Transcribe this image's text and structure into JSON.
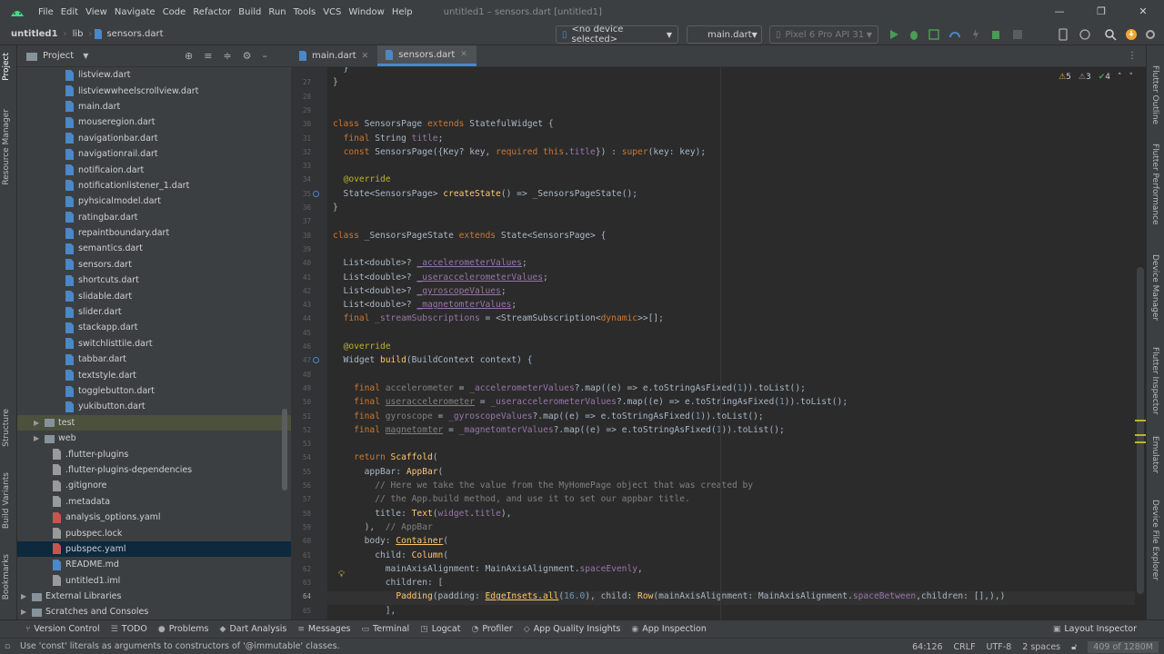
{
  "window": {
    "title": "untitled1 – sensors.dart [untitled1]",
    "menu": [
      "File",
      "Edit",
      "View",
      "Navigate",
      "Code",
      "Refactor",
      "Build",
      "Run",
      "Tools",
      "VCS",
      "Window",
      "Help"
    ]
  },
  "navbar": {
    "breadcrumbs": [
      "untitled1",
      "lib",
      "sensors.dart"
    ],
    "device": "<no device selected>",
    "run_config": "main.dart",
    "emulator": "Pixel 6 Pro API 31"
  },
  "left_stripe": {
    "items": [
      "Project",
      "Resource Manager",
      "Structure",
      "Build Variants",
      "Bookmarks"
    ]
  },
  "project_panel": {
    "title": "Project",
    "files": [
      {
        "name": "listview.dart",
        "indent": 3,
        "type": "dart"
      },
      {
        "name": "listviewwheelscrollview.dart",
        "indent": 3,
        "type": "dart"
      },
      {
        "name": "main.dart",
        "indent": 3,
        "type": "dart"
      },
      {
        "name": "mouseregion.dart",
        "indent": 3,
        "type": "dart"
      },
      {
        "name": "navigationbar.dart",
        "indent": 3,
        "type": "dart"
      },
      {
        "name": "navigationrail.dart",
        "indent": 3,
        "type": "dart"
      },
      {
        "name": "notificaion.dart",
        "indent": 3,
        "type": "dart"
      },
      {
        "name": "notificationlistener_1.dart",
        "indent": 3,
        "type": "dart"
      },
      {
        "name": "pyhsicalmodel.dart",
        "indent": 3,
        "type": "dart"
      },
      {
        "name": "ratingbar.dart",
        "indent": 3,
        "type": "dart"
      },
      {
        "name": "repaintboundary.dart",
        "indent": 3,
        "type": "dart"
      },
      {
        "name": "semantics.dart",
        "indent": 3,
        "type": "dart"
      },
      {
        "name": "sensors.dart",
        "indent": 3,
        "type": "dart"
      },
      {
        "name": "shortcuts.dart",
        "indent": 3,
        "type": "dart"
      },
      {
        "name": "slidable.dart",
        "indent": 3,
        "type": "dart"
      },
      {
        "name": "slider.dart",
        "indent": 3,
        "type": "dart"
      },
      {
        "name": "stackapp.dart",
        "indent": 3,
        "type": "dart"
      },
      {
        "name": "switchlisttile.dart",
        "indent": 3,
        "type": "dart"
      },
      {
        "name": "tabbar.dart",
        "indent": 3,
        "type": "dart"
      },
      {
        "name": "textstyle.dart",
        "indent": 3,
        "type": "dart"
      },
      {
        "name": "togglebutton.dart",
        "indent": 3,
        "type": "dart"
      },
      {
        "name": "yukibutton.dart",
        "indent": 3,
        "type": "dart"
      },
      {
        "name": "test",
        "indent": 1,
        "type": "folder",
        "arrow": "▶",
        "hl": true
      },
      {
        "name": "web",
        "indent": 1,
        "type": "folder",
        "arrow": "▶"
      },
      {
        "name": ".flutter-plugins",
        "indent": 1,
        "type": "file"
      },
      {
        "name": ".flutter-plugins-dependencies",
        "indent": 1,
        "type": "file"
      },
      {
        "name": ".gitignore",
        "indent": 1,
        "type": "file"
      },
      {
        "name": ".metadata",
        "indent": 1,
        "type": "file"
      },
      {
        "name": "analysis_options.yaml",
        "indent": 1,
        "type": "yaml"
      },
      {
        "name": "pubspec.lock",
        "indent": 1,
        "type": "file"
      },
      {
        "name": "pubspec.yaml",
        "indent": 1,
        "type": "yaml",
        "sel": true
      },
      {
        "name": "README.md",
        "indent": 1,
        "type": "md"
      },
      {
        "name": "untitled1.iml",
        "indent": 1,
        "type": "file"
      },
      {
        "name": "External Libraries",
        "indent": 0,
        "type": "lib",
        "arrow": "▶"
      },
      {
        "name": "Scratches and Consoles",
        "indent": 0,
        "type": "scratch",
        "arrow": "▶"
      }
    ]
  },
  "editor": {
    "tabs": [
      {
        "label": "main.dart",
        "active": false
      },
      {
        "label": "sensors.dart",
        "active": true
      }
    ],
    "inspections": {
      "warnings": "5",
      "weak": "3",
      "ok": "4"
    },
    "current_line": "64",
    "lines": [
      {
        "n": "",
        "html": "  }"
      },
      {
        "n": "27",
        "html": "}"
      },
      {
        "n": "28",
        "html": ""
      },
      {
        "n": "29",
        "html": ""
      },
      {
        "n": "30",
        "html": "<span class='kw'>class</span> SensorsPage <span class='kw'>extends</span> StatefulWidget {"
      },
      {
        "n": "31",
        "html": "  <span class='kw'>final</span> String <span class='fld'>title</span>;"
      },
      {
        "n": "32",
        "html": "  <span class='kw'>const</span> SensorsPage({Key? key, <span class='kw'>required this</span>.<span class='fld'>title</span>}) : <span class='kw'>super</span>(key: key);"
      },
      {
        "n": "33",
        "html": ""
      },
      {
        "n": "34",
        "html": "  <span class='ann'>@override</span>"
      },
      {
        "n": "35",
        "html": "  State&lt;SensorsPage&gt; <span class='fn'>createState</span>() =&gt; _SensorsPageState();"
      },
      {
        "n": "36",
        "html": "}"
      },
      {
        "n": "37",
        "html": ""
      },
      {
        "n": "38",
        "html": "<span class='kw'>class</span> _SensorsPageState <span class='kw'>extends</span> State&lt;SensorsPage&gt; {"
      },
      {
        "n": "39",
        "html": ""
      },
      {
        "n": "40",
        "html": "  List&lt;double&gt;? <span class='fld ul'>_accelerometerValues</span>;"
      },
      {
        "n": "41",
        "html": "  List&lt;double&gt;? <span class='fld ul'>_useraccelerometerValues</span>;"
      },
      {
        "n": "42",
        "html": "  List&lt;double&gt;? <span class='fld ul'>_gyroscopeValues</span>;"
      },
      {
        "n": "43",
        "html": "  List&lt;double&gt;? <span class='fld ul'>_magnetomterValues</span>;"
      },
      {
        "n": "44",
        "html": "  <span class='kw'>final</span> <span class='fld'>_streamSubscriptions</span> = &lt;StreamSubscription&lt;<span class='kw'>dynamic</span>&gt;&gt;[];"
      },
      {
        "n": "45",
        "html": ""
      },
      {
        "n": "46",
        "html": "  <span class='ann'>@override</span>"
      },
      {
        "n": "47",
        "html": "  Widget <span class='fn'>build</span>(BuildContext context) {"
      },
      {
        "n": "48",
        "html": ""
      },
      {
        "n": "49",
        "html": "    <span class='kw'>final</span> <span class='cm'>accelerometer</span> = <span class='fld'>_accelerometerValues</span>?.map((e) =&gt; e.toStringAsFixed(<span class='num'>1</span>)).toList();"
      },
      {
        "n": "50",
        "html": "    <span class='kw'>final</span> <span class='cm ul'>useraccelerometer</span> = <span class='fld'>_useraccelerometerValues</span>?.map((e) =&gt; e.toStringAsFixed(<span class='num'>1</span>)).toList();"
      },
      {
        "n": "51",
        "html": "    <span class='kw'>final</span> <span class='cm'>gyroscope</span> = <span class='fld'>_gyroscopeValues</span>?.map((e) =&gt; e.toStringAsFixed(<span class='num'>1</span>)).toList();"
      },
      {
        "n": "52",
        "html": "    <span class='kw'>final</span> <span class='cm ul'>magnetomter</span> = <span class='fld'>_magnetomterValues</span>?.map((e) =&gt; e.toStringAsFixed(<span class='num'>1</span>)).toList();"
      },
      {
        "n": "53",
        "html": ""
      },
      {
        "n": "54",
        "html": "    <span class='kw'>return</span> <span class='fn'>Scaffold</span>("
      },
      {
        "n": "55",
        "html": "      appBar: <span class='fn'>AppBar</span>("
      },
      {
        "n": "56",
        "html": "        <span class='cm'>// Here we take the value from the MyHomePage object that was created by</span>"
      },
      {
        "n": "57",
        "html": "        <span class='cm'>// the App.build method, and use it to set our appbar title.</span>"
      },
      {
        "n": "58",
        "html": "        title: <span class='fn'>Text</span>(<span class='fld'>widget</span>.<span class='fld'>title</span>),"
      },
      {
        "n": "59",
        "html": "      ),  <span class='cm'>// AppBar</span>"
      },
      {
        "n": "60",
        "html": "      body: <span class='fn ul'>Container</span>("
      },
      {
        "n": "61",
        "html": "        child: <span class='fn'>Column</span>("
      },
      {
        "n": "62",
        "html": "          mainAxisAlignment: MainAxisAlignment.<span class='fld'>spaceEvenly</span>,"
      },
      {
        "n": "63",
        "html": "          children: ["
      },
      {
        "n": "64",
        "html": "            <span class='fn'>Padding</span>(padding: <span class='fn ul'>EdgeInsets.all</span>(<span class='num'>16.0</span>), child: <span class='fn'>Row</span>(mainAxisAlignment: MainAxisAlignment.<span class='fld'>spaceBetween</span>,children: [],),)"
      },
      {
        "n": "65",
        "html": "          ],"
      }
    ]
  },
  "right_stripe": {
    "items": [
      "Flutter Outline",
      "Flutter Performance",
      "Device Manager",
      "Flutter Inspector",
      "Emulator",
      "Device File Explorer"
    ]
  },
  "tool_windows": [
    "Version Control",
    "TODO",
    "Problems",
    "Dart Analysis",
    "Messages",
    "Terminal",
    "Logcat",
    "Profiler",
    "App Quality Insights",
    "App Inspection"
  ],
  "layout_inspector": "Layout Inspector",
  "status": {
    "message": "Use 'const' literals as arguments to constructors of '@immutable' classes.",
    "position": "64:126",
    "line_sep": "CRLF",
    "encoding": "UTF-8",
    "indent": "2 spaces",
    "memory": "409 of 1280M"
  },
  "colors": {
    "accent": "#4a88c7",
    "bg": "#2b2b2b",
    "panel": "#3c3f41",
    "keyword": "#cc7832",
    "function": "#ffc66d"
  }
}
